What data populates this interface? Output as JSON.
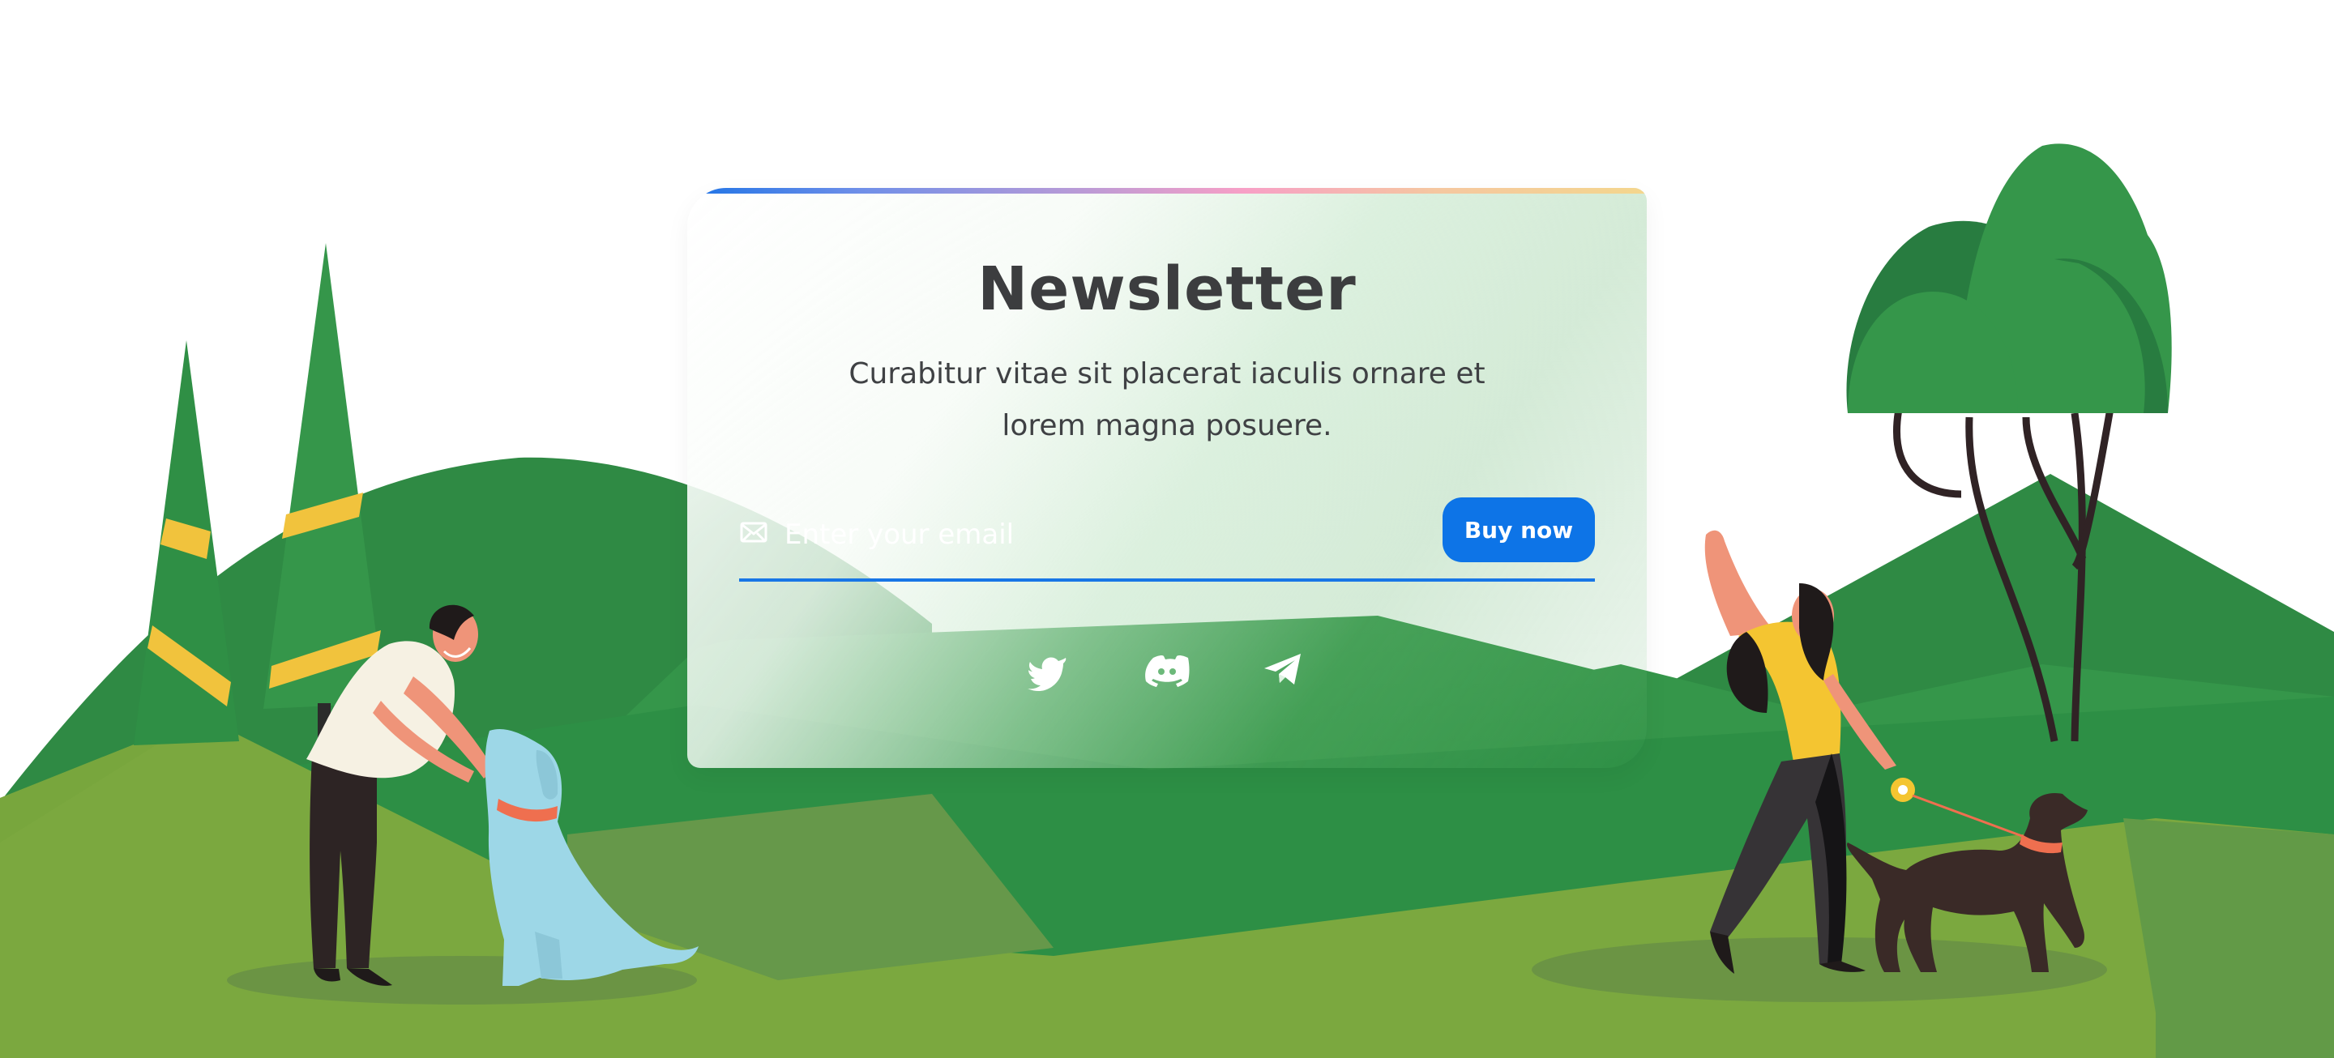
{
  "newsletter": {
    "title": "Newsletter",
    "description": "Curabitur vitae sit placerat iaculis ornare et lorem magna posuere.",
    "email_placeholder": "Enter your email",
    "button_label": "Buy now"
  },
  "socials": [
    {
      "icon": "twitter-icon"
    },
    {
      "icon": "discord-icon"
    },
    {
      "icon": "telegram-icon"
    }
  ],
  "colors": {
    "accent": "#0d74e7",
    "title": "#3c3d3f",
    "hill_dark": "#2d8f45",
    "hill_mid": "#35964a",
    "grass": "#7ba83f"
  }
}
